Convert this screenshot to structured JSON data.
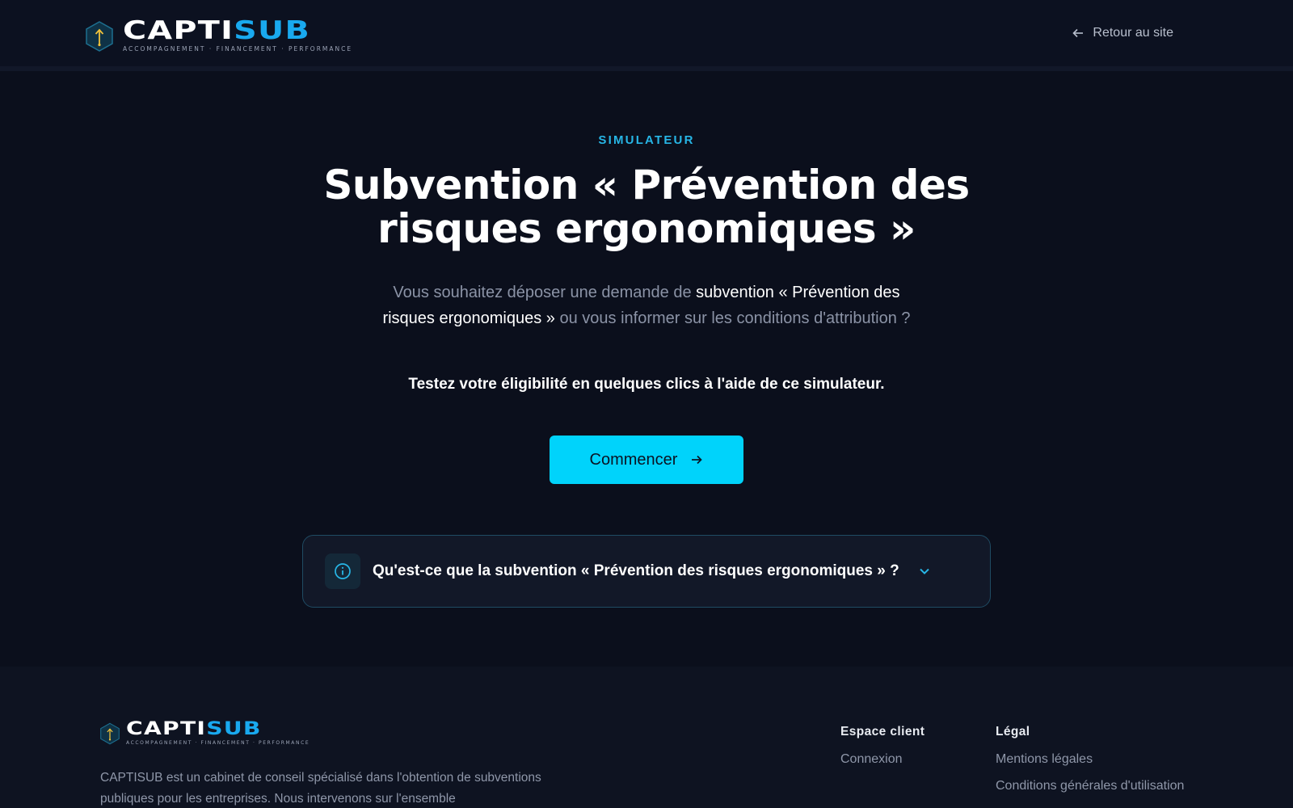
{
  "brand": {
    "name_part1": "CAPTI",
    "name_part2": "SUB",
    "tagline": "ACCOMPAGNEMENT · FINANCEMENT · PERFORMANCE",
    "accent_color": "#19a9ef"
  },
  "header": {
    "back_link_label": "Retour au site",
    "back_icon": "arrow-left-icon"
  },
  "hero": {
    "eyebrow": "SIMULATEUR",
    "title_line1": "Subvention « Prévention des",
    "title_line2": "risques ergonomiques »",
    "lead_part1": "Vous souhaitez déposer une demande de ",
    "lead_strong": "subvention « Prévention des risques ergonomiques »",
    "lead_part2": " ou vous informer sur les conditions d'attribution ?",
    "cta_text": "Testez votre éligibilité en quelques clics à l'aide de ce simulateur.",
    "start_button_label": "Commencer",
    "start_button_color": "#00d3fb"
  },
  "accordion": {
    "title": "Qu'est-ce que la subvention « Prévention des risques ergonomiques » ?",
    "expanded": false,
    "icon": "info-icon"
  },
  "footer": {
    "description": "CAPTISUB est un cabinet de conseil spécialisé dans l'obtention de subventions publiques pour les entreprises. Nous intervenons sur l'ensemble",
    "columns": [
      {
        "heading": "Espace client",
        "links": [
          "Connexion"
        ]
      },
      {
        "heading": "Légal",
        "links": [
          "Mentions légales",
          "Conditions générales d'utilisation"
        ]
      }
    ]
  }
}
